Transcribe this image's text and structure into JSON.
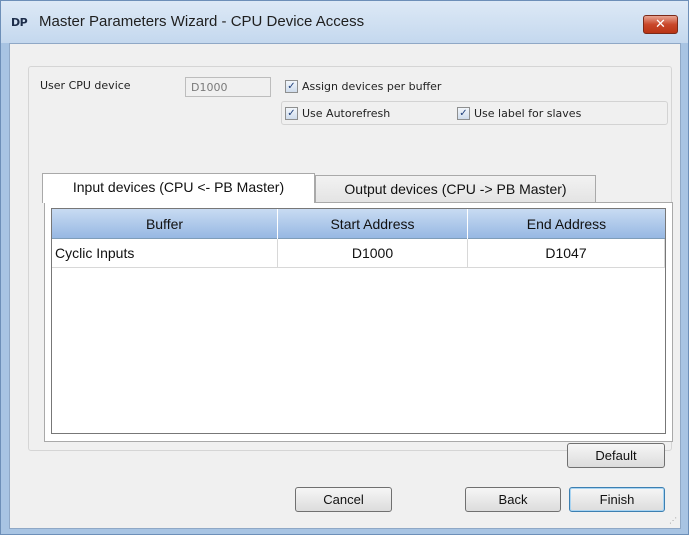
{
  "window": {
    "icon_text": "DP",
    "title": "Master Parameters Wizard - CPU Device Access",
    "close_glyph": "✕"
  },
  "cpu": {
    "label": "User CPU device",
    "value": "D1000"
  },
  "options": {
    "assign_per_buffer": {
      "label": "Assign devices per buffer",
      "checked": true
    },
    "use_autorefresh": {
      "label": "Use Autorefresh",
      "checked": true
    },
    "use_label_for_slaves": {
      "label": "Use label for slaves",
      "checked": true
    }
  },
  "tabs": [
    {
      "label": "Input devices (CPU <- PB Master)",
      "active": true
    },
    {
      "label": "Output devices (CPU -> PB Master)",
      "active": false
    }
  ],
  "grid": {
    "columns": [
      "Buffer",
      "Start Address",
      "End Address"
    ],
    "rows": [
      [
        "Cyclic Inputs",
        "D1000",
        "D1047"
      ]
    ]
  },
  "buttons": {
    "default": "Default",
    "cancel": "Cancel",
    "back": "Back",
    "finish": "Finish"
  },
  "colors": {
    "title_bar": "#c4d8ee",
    "close_button": "#c9472a",
    "grid_header": "#97b8e3"
  },
  "icons": {
    "check": "check-icon",
    "close": "close-icon",
    "grip": "resize-grip-icon"
  }
}
